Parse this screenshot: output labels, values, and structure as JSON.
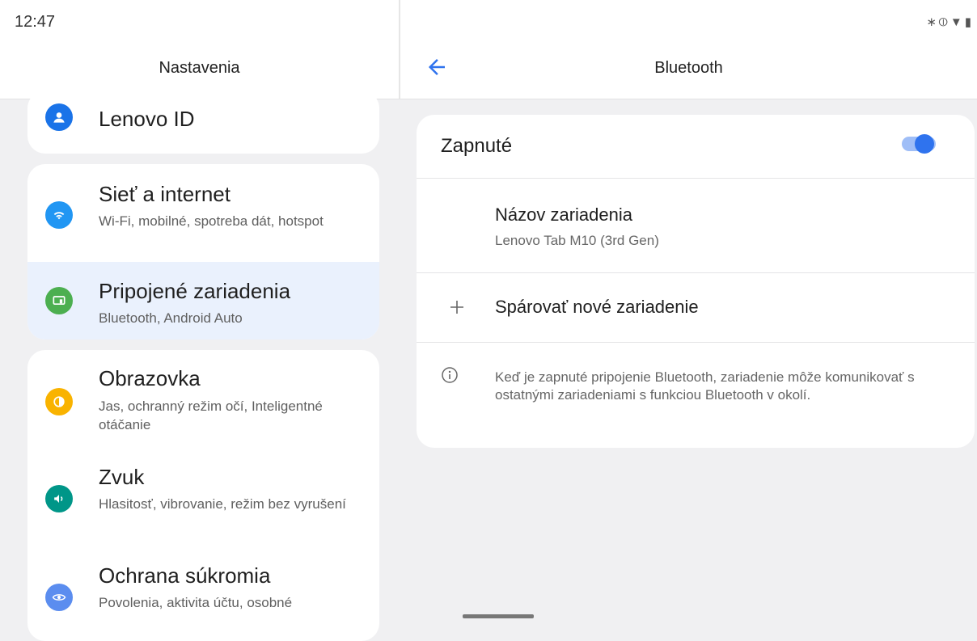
{
  "status_bar": {
    "time": "12:47",
    "icons": [
      "bluetooth-icon",
      "vibrate-icon",
      "wifi-icon",
      "battery-icon"
    ]
  },
  "left_panel": {
    "title": "Nastavenia",
    "items": [
      {
        "title": "Lenovo ID",
        "subtitle": "",
        "icon": "account-icon",
        "color": "#1a73e8"
      },
      {
        "title": "Sieť a internet",
        "subtitle": "Wi-Fi, mobilné, spotreba dát, hotspot",
        "icon": "wifi-icon",
        "color": "#2196f3"
      },
      {
        "title": "Pripojené zariadenia",
        "subtitle": "Bluetooth, Android Auto",
        "icon": "connected-devices-icon",
        "color": "#4caf50",
        "selected": true
      },
      {
        "title": "Obrazovka",
        "subtitle": "Jas, ochranný režim očí, Inteligentné otáčanie",
        "icon": "display-icon",
        "color": "#f9b300"
      },
      {
        "title": "Zvuk",
        "subtitle": "Hlasitosť, vibrovanie, režim bez vyrušení",
        "icon": "sound-icon",
        "color": "#009688"
      },
      {
        "title": "Ochrana súkromia",
        "subtitle": "Povolenia, aktivita účtu, osobné",
        "icon": "privacy-icon",
        "color": "#5b8def"
      }
    ]
  },
  "right_panel": {
    "title": "Bluetooth",
    "toggle": {
      "label": "Zapnuté",
      "on": true,
      "accent": "#2f73ee"
    },
    "device_name": {
      "title": "Názov zariadenia",
      "value": "Lenovo Tab M10 (3rd Gen)"
    },
    "pair": {
      "label": "Spárovať nové zariadenie"
    },
    "info": "Keď je zapnuté pripojenie Bluetooth, zariadenie môže komunikovať s ostatnými zariadeniami s funkciou Bluetooth v okolí."
  }
}
